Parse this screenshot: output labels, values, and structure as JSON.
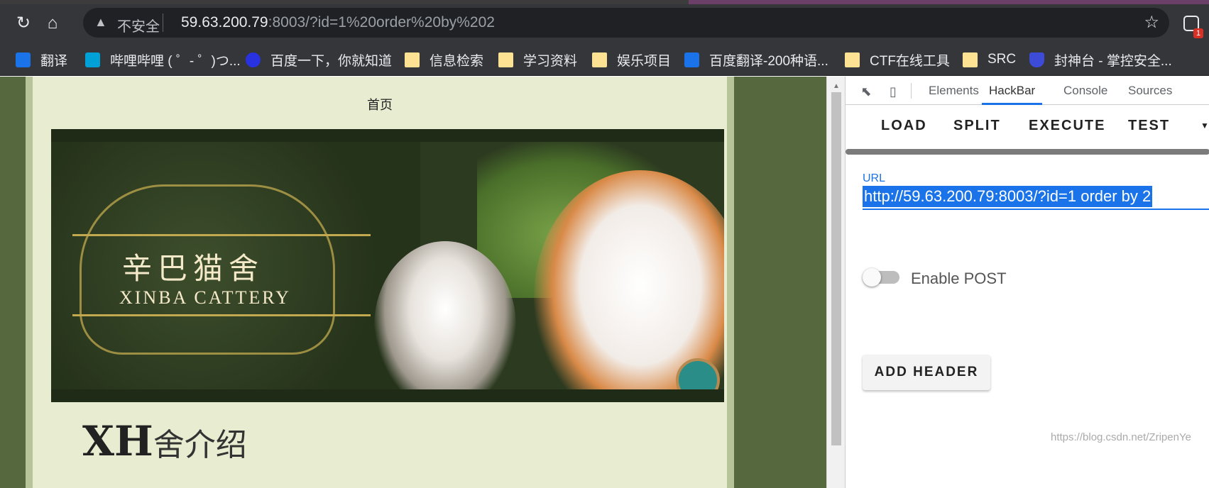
{
  "browser": {
    "address": {
      "security_text": "不安全",
      "url_host": "59.63.200.79",
      "url_rest": ":8003/?id=1%20order%20by%202"
    },
    "extension_badge": "1",
    "bookmarks": [
      {
        "label": "翻译",
        "icon": "translate-icon"
      },
      {
        "label": "哔哩哔哩 ( ゜- ゜)つ...",
        "icon": "bilibili-icon"
      },
      {
        "label": "百度一下，你就知道",
        "icon": "baidu-icon"
      },
      {
        "label": "信息检索",
        "icon": "folder-icon"
      },
      {
        "label": "学习资料",
        "icon": "folder-icon"
      },
      {
        "label": "娱乐项目",
        "icon": "folder-icon"
      },
      {
        "label": "百度翻译-200种语...",
        "icon": "baidu-translate-icon"
      },
      {
        "label": "CTF在线工具",
        "icon": "folder-icon"
      },
      {
        "label": "SRC",
        "icon": "folder-icon"
      },
      {
        "label": "封神台 - 掌控安全...",
        "icon": "shield-icon"
      }
    ]
  },
  "page": {
    "nav_home": "首页",
    "banner_title_cn": "辛巴猫舍",
    "banner_title_en": "XINBA CATTERY",
    "section_heading_partial": "XH",
    "section_heading": "舍介绍",
    "watermark": "https://blog.csdn.net/ZripenYe"
  },
  "devtools": {
    "tabs": [
      "Elements",
      "HackBar",
      "Console",
      "Sources"
    ],
    "active_tab": "HackBar",
    "hackbar": {
      "buttons": [
        "LOAD",
        "SPLIT",
        "EXECUTE",
        "TEST"
      ],
      "url_label": "URL",
      "url_value": "http://59.63.200.79:8003/?id=1 order by 2",
      "enable_post_label": "Enable POST",
      "enable_post": false,
      "add_header_label": "ADD HEADER"
    }
  },
  "colors": {
    "accent": "#1a73e8",
    "page_bg": "#56683e"
  }
}
